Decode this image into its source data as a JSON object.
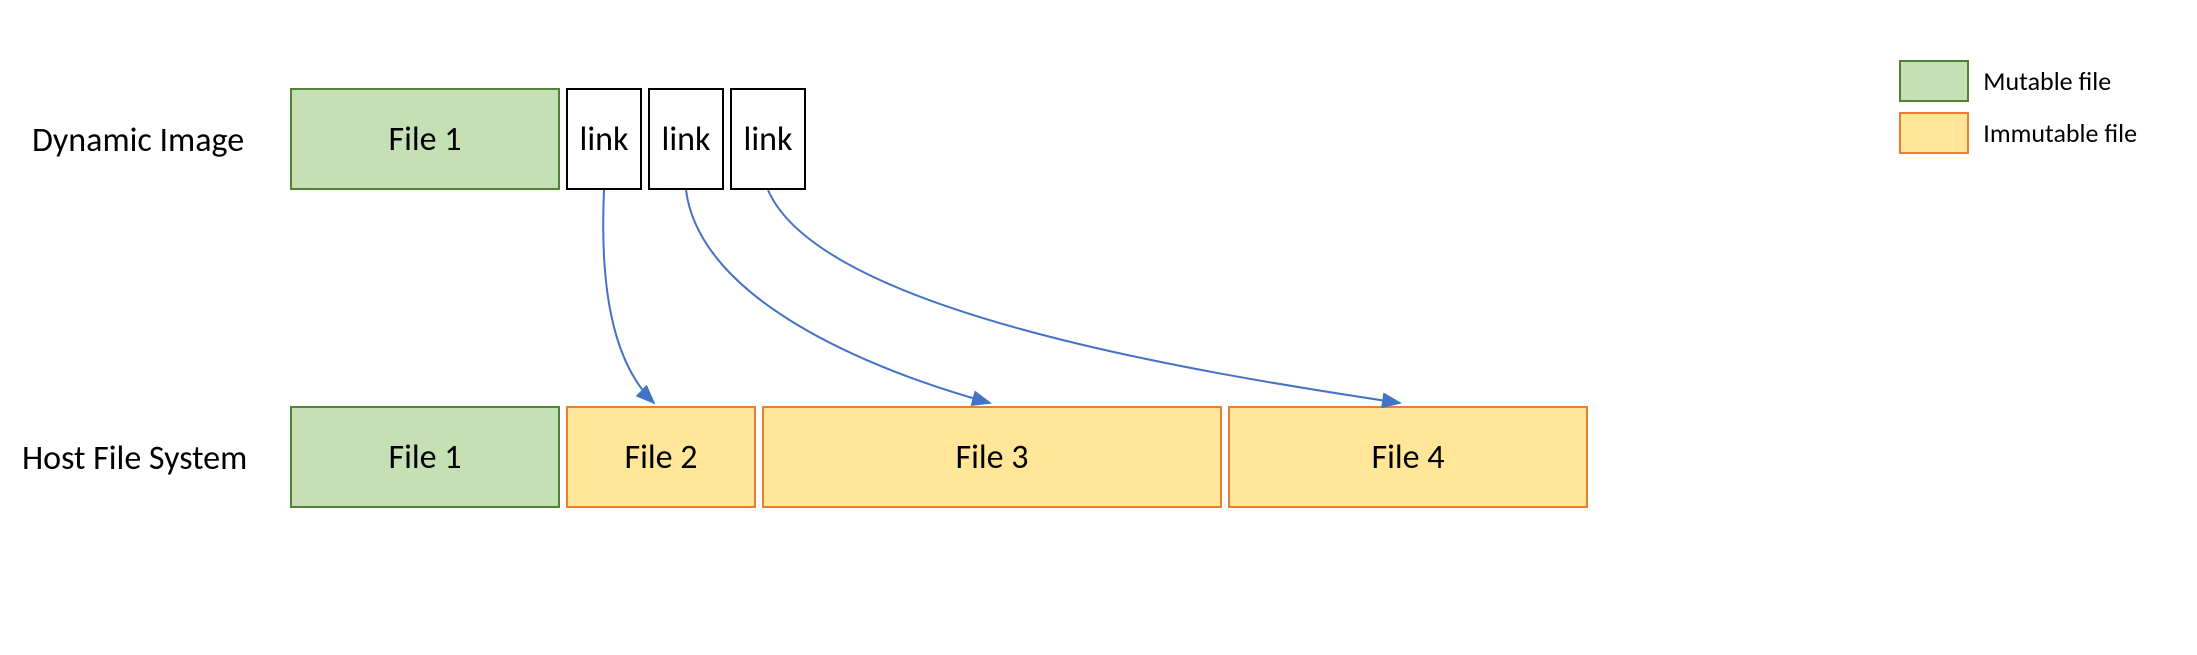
{
  "rows": {
    "dynamic_image_label": "Dynamic Image",
    "host_fs_label": "Host File System"
  },
  "top_row": {
    "file1": "File 1",
    "link1": "link",
    "link2": "link",
    "link3": "link"
  },
  "bottom_row": {
    "file1": "File 1",
    "file2": "File 2",
    "file3": "File 3",
    "file4": "File 4"
  },
  "legend": {
    "mutable": "Mutable file",
    "immutable": "Immutable file"
  },
  "colors": {
    "mutable_fill": "#c5e0b4",
    "mutable_stroke": "#548235",
    "immutable_fill": "#ffe699",
    "immutable_stroke": "#ed7d31",
    "arrow": "#4472c4"
  }
}
